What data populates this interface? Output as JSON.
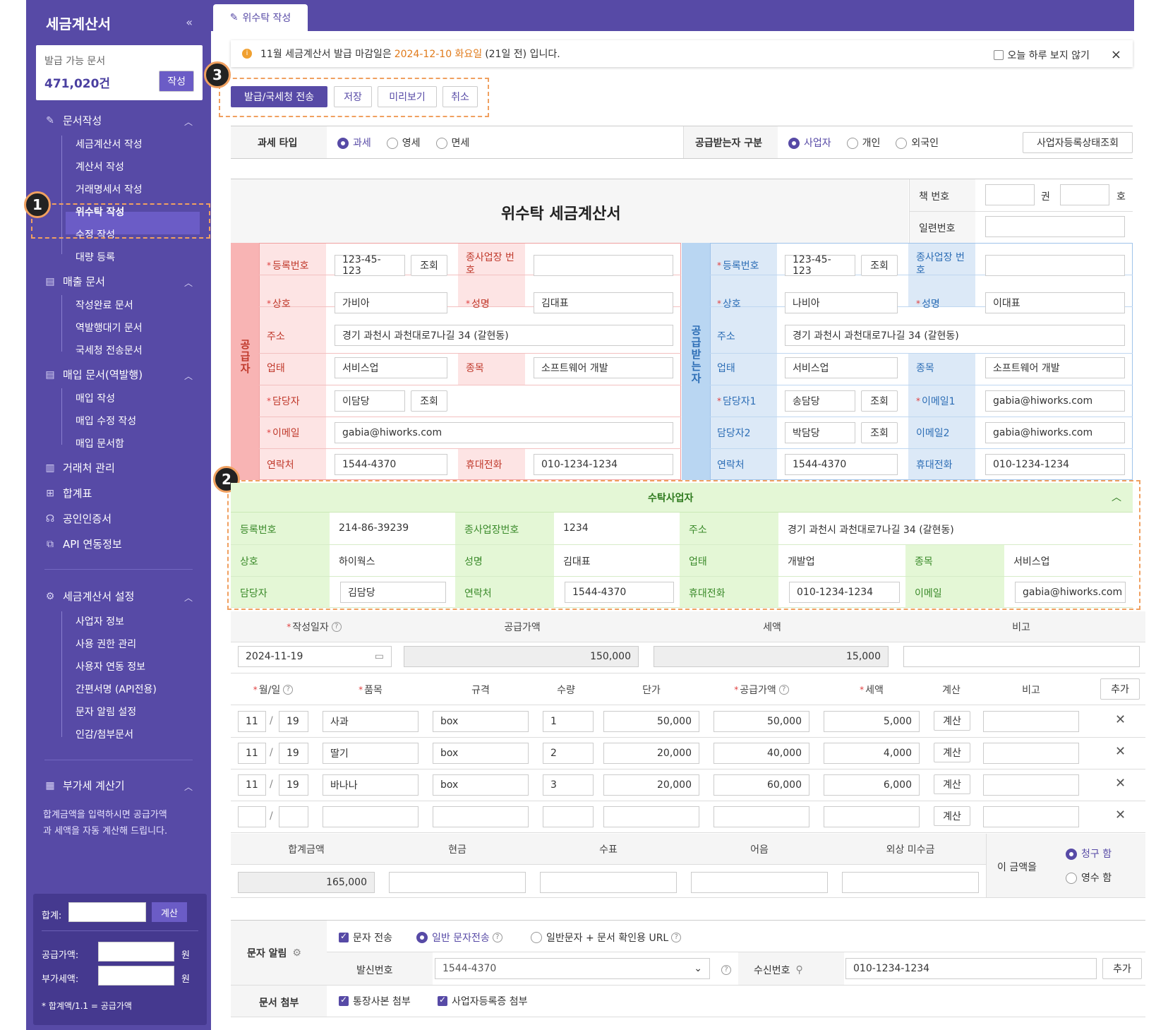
{
  "sidebar": {
    "title": "세금계산서",
    "collapse": "«",
    "doc_card": {
      "label": "발급 가능 문서",
      "count": "471,020건",
      "write_btn": "작성"
    },
    "groups": [
      {
        "label": "문서작성",
        "items": [
          "세금계산서 작성",
          "계산서 작성",
          "거래명세서 작성",
          "위수탁 작성",
          "수정 작성",
          "대량 등록"
        ]
      },
      {
        "label": "매출 문서",
        "items": [
          "작성완료 문서",
          "역발행대기 문서",
          "국세청 전송문서"
        ]
      },
      {
        "label": "매입 문서(역발행)",
        "items": [
          "매입 작성",
          "매입 수정 작성",
          "매입 문서함"
        ]
      }
    ],
    "links": [
      "거래처 관리",
      "합계표",
      "공인인증서",
      "API 연동정보"
    ],
    "settings": {
      "label": "세금계산서 설정",
      "items": [
        "사업자 정보",
        "사용 권한 관리",
        "사용자 연동 정보",
        "간편서명 (API전용)",
        "문자 알림 설정",
        "인감/첨부문서"
      ]
    },
    "vat": {
      "label": "부가세 계산기",
      "desc1": "합계금액을 입력하시면 공급가액",
      "desc2": "과 세액을 자동 계산해 드립니다.",
      "total_label": "합계:",
      "calc_btn": "계산",
      "supply_label": "공급가액:",
      "tax_label": "부가세액:",
      "won": "원",
      "note": "* 합계액/1.1 = 공급가액"
    }
  },
  "tab": {
    "label": "위수탁 작성"
  },
  "notice": {
    "prefix": "11월 세금계산서 발급 마감일은 ",
    "date": "2024-12-10 화요일",
    "suffix": " (21일 전) 입니다.",
    "hide_today": "오늘 하루 보지 않기",
    "close": "×"
  },
  "badges": [
    "1",
    "2",
    "3"
  ],
  "actions": {
    "issue": "발급/국세청 전송",
    "save": "저장",
    "preview": "미리보기",
    "cancel": "취소"
  },
  "tax_type": {
    "label": "과세 타입",
    "options": [
      "과세",
      "영세",
      "면세"
    ],
    "selected": "과세"
  },
  "receiver_type": {
    "label": "공급받는자 구분",
    "options": [
      "사업자",
      "개인",
      "외국인"
    ],
    "selected": "사업자",
    "status_btn": "사업자등록상태조회"
  },
  "doc": {
    "title": "위수탁 세금계산서",
    "book_label": "책 번호",
    "gwon": "권",
    "ho": "호",
    "serial_label": "일련번호"
  },
  "supplier": {
    "side_label": "공급자",
    "reg_label": "등록번호",
    "reg_value": "123-45-123",
    "lookup": "조회",
    "branch_label": "종사업장 번호",
    "name_label": "상호",
    "name_value": "가비아",
    "ceo_label": "성명",
    "ceo_value": "김대표",
    "addr_label": "주소",
    "addr_value": "경기 과천시 과천대로7나길 34 (갈현동)",
    "biz_label": "업태",
    "biz_value": "서비스업",
    "item_label": "종목",
    "item_value": "소프트웨어 개발",
    "manager_label": "담당자",
    "manager_value": "이담당",
    "email_label": "이메일",
    "email_value": "gabia@hiworks.com",
    "tel_label": "연락처",
    "tel_value": "1544-4370",
    "mobile_label": "휴대전화",
    "mobile_value": "010-1234-1234"
  },
  "receiver": {
    "side_label": "공급받는자",
    "reg_label": "등록번호",
    "reg_value": "123-45-123",
    "lookup": "조회",
    "branch_label": "종사업장 번호",
    "name_label": "상호",
    "name_value": "나비아",
    "ceo_label": "성명",
    "ceo_value": "이대표",
    "addr_label": "주소",
    "addr_value": "경기 과천시 과천대로7나길 34 (갈현동)",
    "biz_label": "업태",
    "biz_value": "서비스업",
    "item_label": "종목",
    "item_value": "소프트웨어 개발",
    "manager1_label": "담당자1",
    "manager1_value": "송담당",
    "email1_label": "이메일1",
    "email1_value": "gabia@hiworks.com",
    "manager2_label": "담당자2",
    "manager2_value": "박담당",
    "email2_label": "이메일2",
    "email2_value": "gabia@hiworks.com",
    "tel_label": "연락처",
    "tel_value": "1544-4370",
    "mobile_label": "휴대전화",
    "mobile_value": "010-1234-1234"
  },
  "trustee": {
    "header": "수탁사업자",
    "reg_label": "등록번호",
    "reg_value": "214-86-39239",
    "branch_label": "종사업장번호",
    "branch_value": "1234",
    "addr_label": "주소",
    "addr_value": "경기 과천시 과천대로7나길 34 (갈현동)",
    "name_label": "상호",
    "name_value": "하이웍스",
    "ceo_label": "성명",
    "ceo_value": "김대표",
    "biz_label": "업태",
    "biz_value": "개발업",
    "item_label": "종목",
    "item_value": "서비스업",
    "manager_label": "담당자",
    "manager_value": "김담당",
    "tel_label": "연락처",
    "tel_value": "1544-4370",
    "mobile_label": "휴대전화",
    "mobile_value": "010-1234-1234",
    "email_label": "이메일",
    "email_value": "gabia@hiworks.com"
  },
  "summary": {
    "date_label": "작성일자",
    "supply_label": "공급가액",
    "tax_label": "세액",
    "note_label": "비고",
    "date_value": "2024-11-19",
    "supply_value": "150,000",
    "tax_value": "15,000"
  },
  "items": {
    "headers": [
      "월/일",
      "품목",
      "규격",
      "수량",
      "단가",
      "공급가액",
      "세액",
      "계산",
      "비고"
    ],
    "add_btn": "추가",
    "calc_btn": "계산",
    "rows": [
      {
        "m": "11",
        "d": "19",
        "name": "사과",
        "spec": "box",
        "qty": "1",
        "price": "50,000",
        "supply": "50,000",
        "tax": "5,000"
      },
      {
        "m": "11",
        "d": "19",
        "name": "딸기",
        "spec": "box",
        "qty": "2",
        "price": "20,000",
        "supply": "40,000",
        "tax": "4,000"
      },
      {
        "m": "11",
        "d": "19",
        "name": "바나나",
        "spec": "box",
        "qty": "3",
        "price": "20,000",
        "supply": "60,000",
        "tax": "6,000"
      },
      {
        "m": "",
        "d": "",
        "name": "",
        "spec": "",
        "qty": "",
        "price": "",
        "supply": "",
        "tax": ""
      }
    ]
  },
  "totals": {
    "headers": [
      "합계금액",
      "현금",
      "수표",
      "어음",
      "외상 미수금"
    ],
    "total_value": "165,000",
    "amount_label": "이 금액을",
    "options": [
      "청구 함",
      "영수 함"
    ],
    "selected": "청구 함"
  },
  "sms": {
    "label": "문자 알림",
    "send_label": "문자 전송",
    "opt1": "일반 문자전송",
    "opt2": "일반문자 + 문서 확인용 URL",
    "from_label": "발신번호",
    "from_value": "1544-4370",
    "to_label": "수신번호",
    "to_value": "010-1234-1234",
    "add_btn": "추가"
  },
  "attach": {
    "label": "문서 첨부",
    "opt1": "통장사본 첨부",
    "opt2": "사업자등록증 첨부"
  },
  "colors": {
    "accent": "#574aa6",
    "supplier_bg": "#fde4e4",
    "supplier_side": "#f8b4b4",
    "receiver_bg": "#dce9f7",
    "receiver_side": "#b9d6f2",
    "trustee_bg": "#e4f7d6",
    "highlight": "#f0a060"
  }
}
